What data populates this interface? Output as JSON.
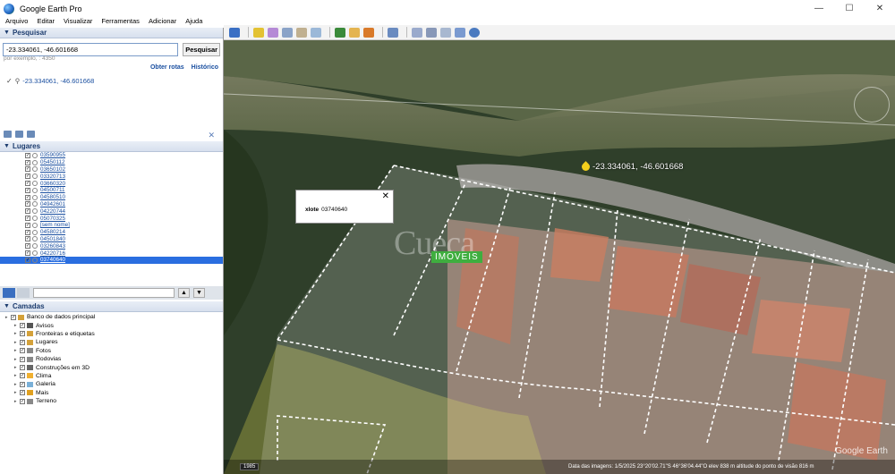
{
  "window": {
    "title": "Google Earth Pro",
    "minimize": "—",
    "maximize": "☐",
    "close": "✕"
  },
  "menu": [
    "Arquivo",
    "Editar",
    "Visualizar",
    "Ferramentas",
    "Adicionar",
    "Ajuda"
  ],
  "search": {
    "section_title": "Pesquisar",
    "value": "-23.334061, -46.601668",
    "button": "Pesquisar",
    "hint": "por exemplo, : 4350",
    "links": [
      "Obter rotas",
      "Histórico"
    ],
    "result": "-23.334061, -46.601668"
  },
  "places": {
    "section_title": "Lugares",
    "items": [
      "03590955",
      "05450112",
      "03650102",
      "03320713",
      "03660320",
      "04500711",
      "04580510",
      "04942601",
      "04220744",
      "05070325",
      "[sem nome]",
      "04580214",
      "04501840",
      "03260843",
      "04220716",
      "03740640"
    ],
    "selected": "03740640"
  },
  "layers": {
    "section_title": "Camadas",
    "items": [
      {
        "label": "Banco de dados principal",
        "indent": 0
      },
      {
        "label": "Avisos",
        "indent": 1
      },
      {
        "label": "Fronteiras e etiquetas",
        "indent": 1
      },
      {
        "label": "Lugares",
        "indent": 1
      },
      {
        "label": "Fotos",
        "indent": 1
      },
      {
        "label": "Rodovias",
        "indent": 1
      },
      {
        "label": "Construções em 3D",
        "indent": 1
      },
      {
        "label": "Clima",
        "indent": 1
      },
      {
        "label": "Galeria",
        "indent": 1
      },
      {
        "label": "Mais",
        "indent": 1
      },
      {
        "label": "Terreno",
        "indent": 1
      }
    ]
  },
  "map": {
    "coord_label": "-23.334061, -46.601668",
    "balloon_key": "xlote",
    "balloon_value": "03740640",
    "watermark_name": "Cueca",
    "watermark_tag": "IMOVEIS",
    "year": "1985",
    "status": "Data das imagens: 1/5/2025   23°20'02.71\"S  46°36'04.44\"O  elev  838 m   altitude do ponto de visão  816 m",
    "logo": "Google Earth"
  }
}
